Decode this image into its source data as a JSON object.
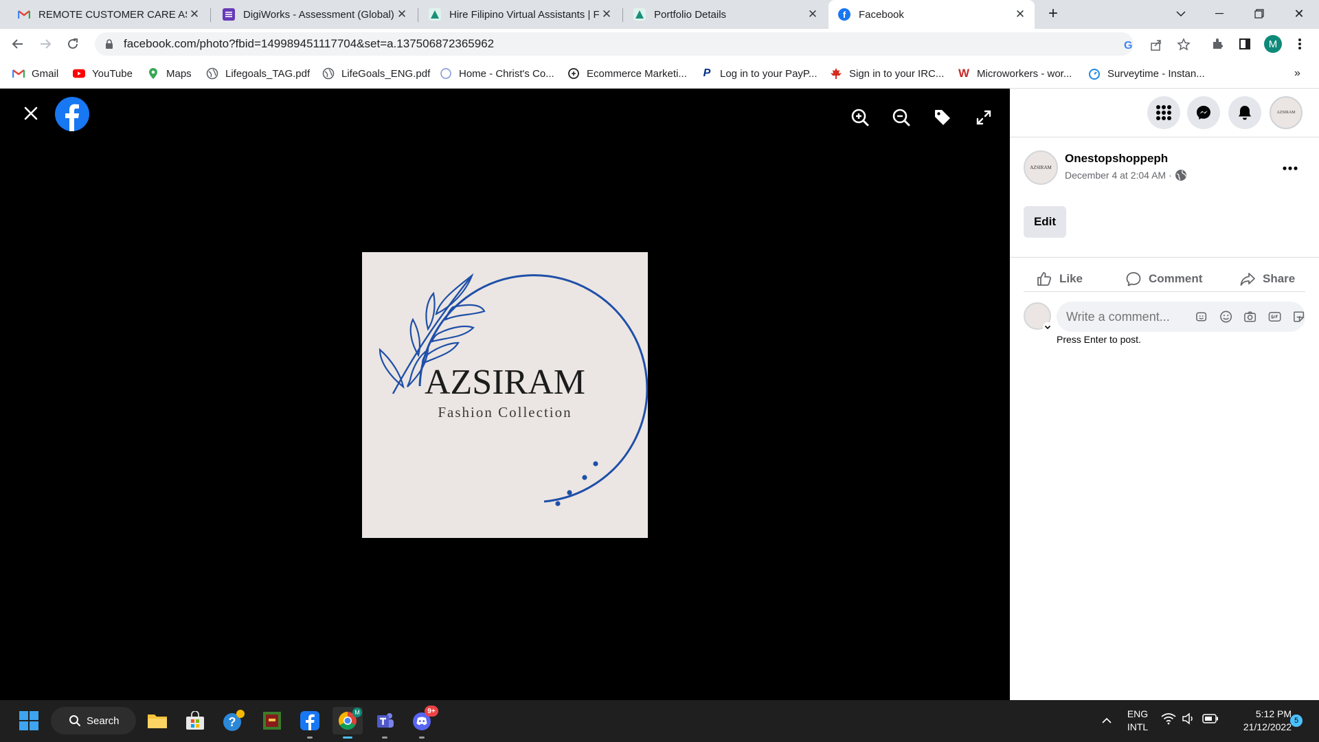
{
  "browser": {
    "tabs": [
      {
        "title": "REMOTE CUSTOMER CARE ASSO",
        "icon": "gmail-icon"
      },
      {
        "title": "DigiWorks - Assessment (Global)",
        "icon": "forms-icon"
      },
      {
        "title": "Hire Filipino Virtual Assistants | Fi",
        "icon": "site-icon"
      },
      {
        "title": "Portfolio Details",
        "icon": "site-icon"
      },
      {
        "title": "Facebook",
        "icon": "facebook-icon"
      }
    ],
    "url": "facebook.com/photo?fbid=149989451117704&set=a.137506872365962",
    "profile_initial": "M",
    "bookmarks": [
      {
        "label": "Gmail"
      },
      {
        "label": "YouTube"
      },
      {
        "label": "Maps"
      },
      {
        "label": "Lifegoals_TAG.pdf"
      },
      {
        "label": "LifeGoals_ENG.pdf"
      },
      {
        "label": "Home - Christ's Co..."
      },
      {
        "label": "Ecommerce Marketi..."
      },
      {
        "label": "Log in to your PayP..."
      },
      {
        "label": "Sign in to your IRC..."
      },
      {
        "label": "Microworkers - wor..."
      },
      {
        "label": "Surveytime - Instan..."
      }
    ],
    "bookmarks_overflow": "»"
  },
  "photo": {
    "brand": "AZSIRAM",
    "tagline": "Fashion Collection",
    "avatar_text": "AZSIRAM"
  },
  "post": {
    "author": "Onestopshoppeph",
    "timestamp": "December 4 at 2:04 AM",
    "dot": "·",
    "edit_label": "Edit",
    "like_label": "Like",
    "comment_label": "Comment",
    "share_label": "Share",
    "comment_placeholder": "Write a comment...",
    "hint": "Press Enter to post."
  },
  "taskbar": {
    "search_label": "Search",
    "lang_top": "ENG",
    "lang_bottom": "INTL",
    "time": "5:12 PM",
    "date": "21/12/2022",
    "notification_count": "5",
    "discord_badge": "9+",
    "chrome_badge": "M"
  },
  "colors": {
    "facebook_blue": "#1877f2",
    "logo_blue": "#1f4fa8"
  }
}
